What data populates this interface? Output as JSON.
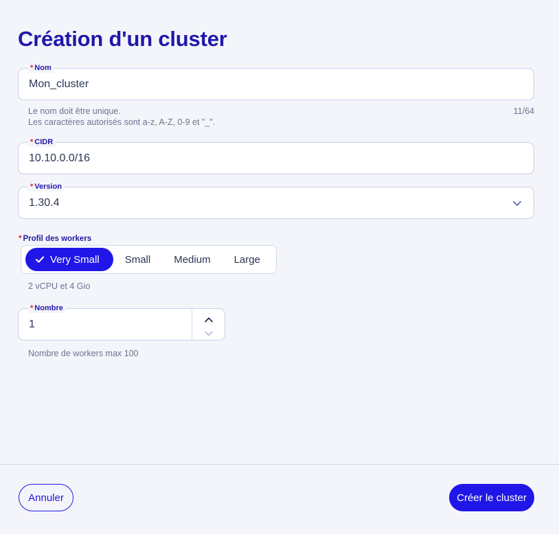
{
  "page": {
    "title": "Création d'un cluster",
    "title_color": "#2118a8",
    "background_color": "#f4f5fa",
    "accent_color": "#2016e8",
    "required_marker": "*",
    "required_marker_color": "#d8232a"
  },
  "form": {
    "nom": {
      "label": "Nom",
      "value": "Mon_cluster",
      "placeholder": "",
      "helper_line1": "Le nom doit être unique.",
      "helper_line2": "Les caractères autorisés sont a-z, A-Z, 0-9 et \"_\".",
      "counter": "11/64",
      "required": true
    },
    "cidr": {
      "label": "CIDR",
      "value": "10.10.0.0/16",
      "placeholder": "",
      "required": true
    },
    "version": {
      "label": "Version",
      "value": "1.30.4",
      "chevron_icon": "chevron-down-icon",
      "required": true,
      "options": [
        "1.30.4"
      ]
    },
    "profil_workers": {
      "label": "Profil des workers",
      "required": true,
      "selected": "Very Small",
      "check_icon": "check-icon",
      "options": [
        {
          "label": "Very Small",
          "selected": true
        },
        {
          "label": "Small",
          "selected": false
        },
        {
          "label": "Medium",
          "selected": false
        },
        {
          "label": "Large",
          "selected": false
        }
      ],
      "helper": "2 vCPU et 4 Gio"
    },
    "nombre": {
      "label": "Nombre",
      "value": "1",
      "required": true,
      "helper": "Nombre de workers max 100",
      "increment_icon": "chevron-up-icon",
      "decrement_icon": "chevron-down-icon"
    }
  },
  "footer": {
    "cancel_label": "Annuler",
    "submit_label": "Créer le cluster"
  }
}
